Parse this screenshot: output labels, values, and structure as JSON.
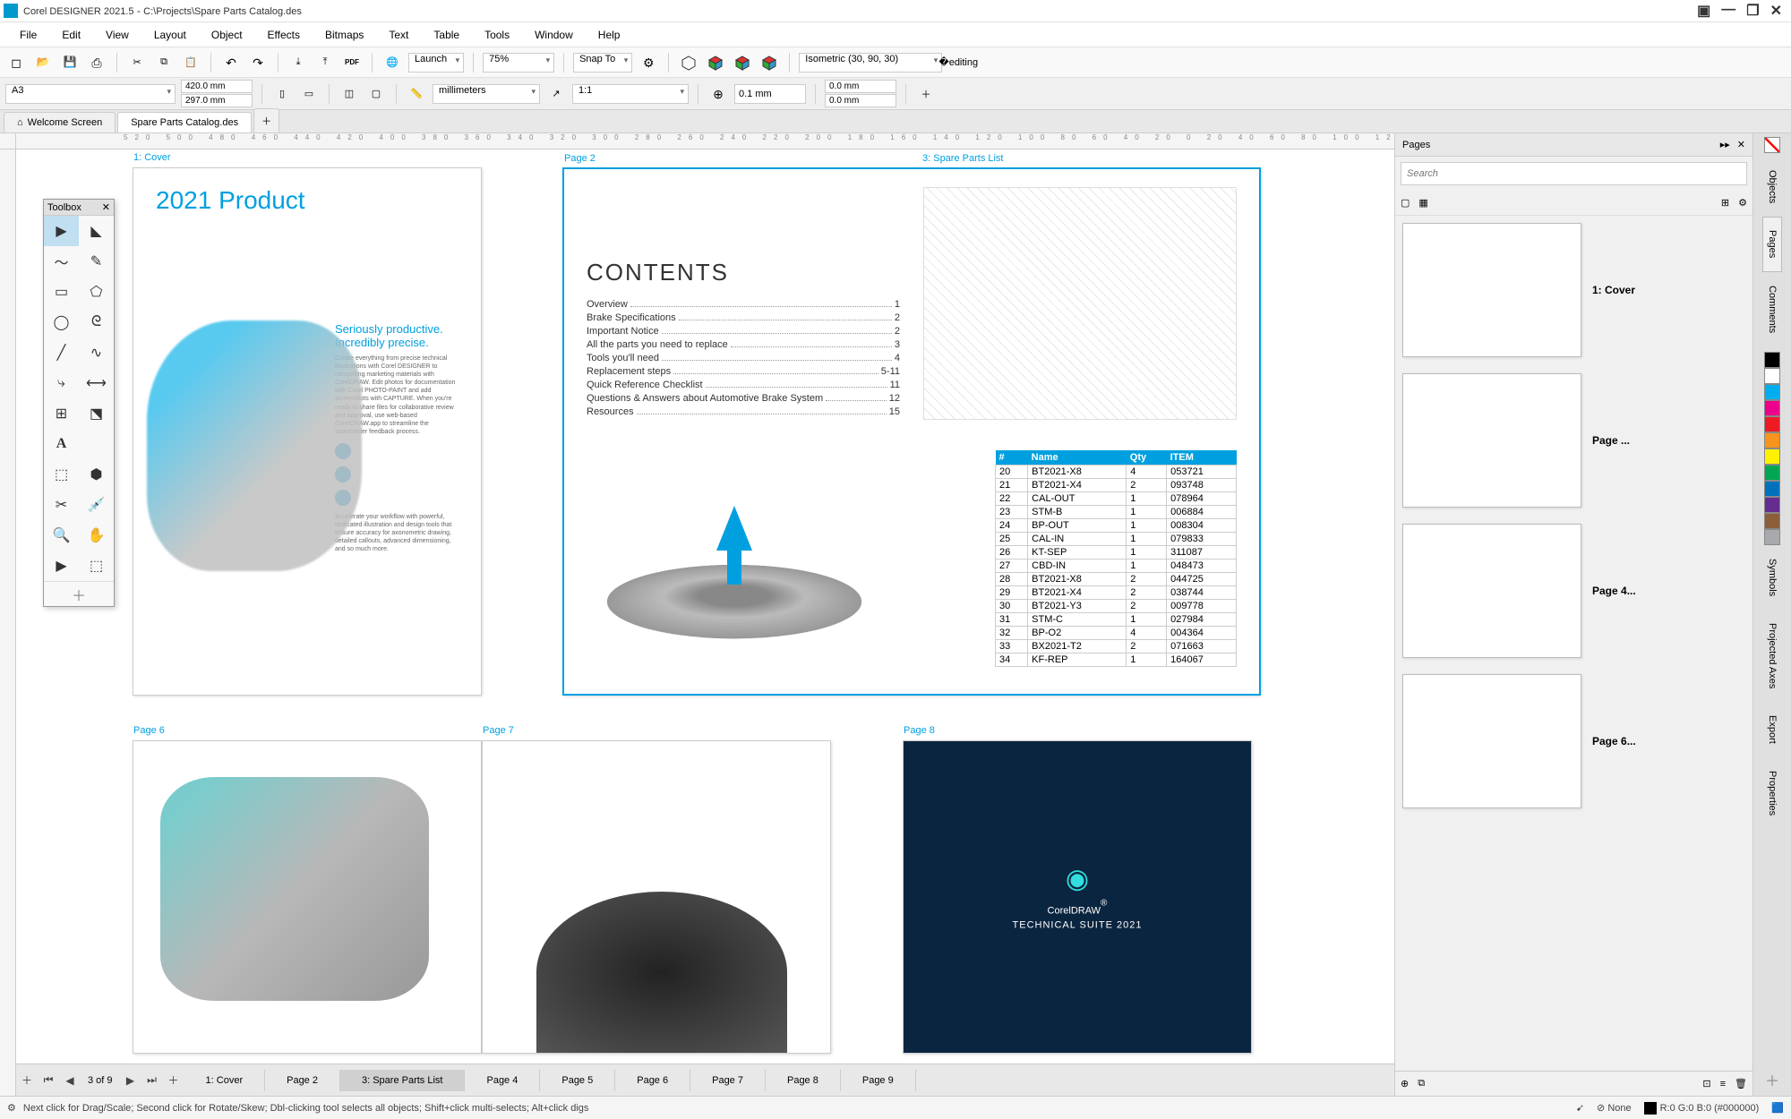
{
  "app": {
    "name": "Corel DESIGNER 2021.5",
    "file_path": "C:\\Projects\\Spare Parts Catalog.des"
  },
  "menu": [
    "File",
    "Edit",
    "View",
    "Layout",
    "Object",
    "Effects",
    "Bitmaps",
    "Text",
    "Table",
    "Tools",
    "Window",
    "Help"
  ],
  "toolbar1": {
    "launch_label": "Launch",
    "zoom": "75%",
    "snap_label": "Snap To",
    "projection": "Isometric (30, 90, 30)"
  },
  "toolbar2": {
    "page_size": "A3",
    "width": "420.0 mm",
    "height": "297.0 mm",
    "units": "millimeters",
    "ratio": "1:1",
    "nudge": "0.1 mm",
    "dup_x": "0.0 mm",
    "dup_y": "0.0 mm"
  },
  "doc_tabs": {
    "welcome": "Welcome Screen",
    "current": "Spare Parts Catalog.des"
  },
  "ruler_unit_label": "millimeters",
  "toolbox_title": "Toolbox",
  "canvas_pages": {
    "cover_label": "1: Cover",
    "p2_label": "Page 2",
    "p3_label": "3: Spare Parts List",
    "p6_label": "Page 6",
    "p7_label": "Page 7",
    "p8_label": "Page 8"
  },
  "cover": {
    "title": "2021 Product",
    "sub1": "Seriously productive.",
    "sub2": "Incredibly precise.",
    "para1": "Create everything from precise technical illustrations with Corel DESIGNER to compelling marketing materials with CorelDRAW. Edit photos for documentation with Corel PHOTO-PAINT and add screenshots with CAPTURE. When you're ready to share files for collaborative review and approval, use web-based CorelDRAW.app to streamline the stakeholder feedback process.",
    "para2": "Accelerate your workflow with powerful, dedicated illustration and design tools that ensure accuracy for axonometric drawing, detailed callouts, advanced dimensioning, and so much more."
  },
  "contents": {
    "heading": "CONTENTS",
    "items": [
      {
        "t": "Overview",
        "p": "1"
      },
      {
        "t": "Brake Specifications",
        "p": "2"
      },
      {
        "t": "Important Notice",
        "p": "2"
      },
      {
        "t": "All the parts you need to replace",
        "p": "3"
      },
      {
        "t": "Tools you'll need",
        "p": "4"
      },
      {
        "t": "Replacement steps",
        "p": "5-11"
      },
      {
        "t": "Quick Reference Checklist",
        "p": "11"
      },
      {
        "t": "Questions & Answers about Automotive Brake System",
        "p": "12"
      },
      {
        "t": "Resources",
        "p": "15"
      }
    ]
  },
  "parts_table": {
    "headers": [
      "#",
      "Name",
      "Qty",
      "ITEM"
    ],
    "rows": [
      [
        "20",
        "BT2021-X8",
        "4",
        "053721"
      ],
      [
        "21",
        "BT2021-X4",
        "2",
        "093748"
      ],
      [
        "22",
        "CAL-OUT",
        "1",
        "078964"
      ],
      [
        "23",
        "STM-B",
        "1",
        "006884"
      ],
      [
        "24",
        "BP-OUT",
        "1",
        "008304"
      ],
      [
        "25",
        "CAL-IN",
        "1",
        "079833"
      ],
      [
        "26",
        "KT-SEP",
        "1",
        "311087"
      ],
      [
        "27",
        "CBD-IN",
        "1",
        "048473"
      ],
      [
        "28",
        "BT2021-X8",
        "2",
        "044725"
      ],
      [
        "29",
        "BT2021-X4",
        "2",
        "038744"
      ],
      [
        "30",
        "BT2021-Y3",
        "2",
        "009778"
      ],
      [
        "31",
        "STM-C",
        "1",
        "027984"
      ],
      [
        "32",
        "BP-O2",
        "4",
        "004364"
      ],
      [
        "33",
        "BX2021-T2",
        "2",
        "071663"
      ],
      [
        "34",
        "KF-REP",
        "1",
        "164067"
      ]
    ]
  },
  "corel_brand": {
    "name": "CorelDRAW",
    "suite": "TECHNICAL SUITE 2021"
  },
  "page_nav": {
    "counter": "3 of 9",
    "tabs": [
      "1: Cover",
      "Page 2",
      "3: Spare Parts List",
      "Page 4",
      "Page 5",
      "Page 6",
      "Page 7",
      "Page 8",
      "Page 9"
    ],
    "active_index": 2
  },
  "docker": {
    "title": "Pages",
    "search_placeholder": "Search",
    "items": [
      {
        "label": "1: Cover"
      },
      {
        "label": "Page ..."
      },
      {
        "label": "Page 4..."
      },
      {
        "label": "Page 6..."
      }
    ]
  },
  "side_tabs": [
    "Objects",
    "Pages",
    "Comments",
    "Symbols",
    "Projected Axes",
    "Export",
    "Properties"
  ],
  "color_palette": [
    "#000000",
    "#ffffff",
    "#00aeef",
    "#ec008c",
    "#ed1c24",
    "#f7941d",
    "#fff200",
    "#00a651",
    "#0072bc",
    "#662d91",
    "#8b5e3c",
    "#a7a9ac"
  ],
  "status": {
    "hint": "Next click for Drag/Scale; Second click for Rotate/Skew; Dbl-clicking tool selects all objects; Shift+click multi-selects; Alt+click digs",
    "fill_label": "None",
    "color_readout": "R:0 G:0 B:0 (#000000)"
  }
}
